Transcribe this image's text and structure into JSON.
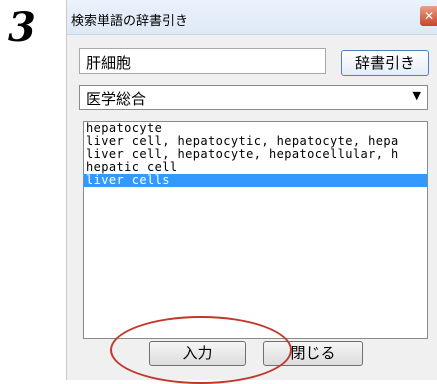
{
  "step_number": "3",
  "window": {
    "title": "検索単語の辞書引き"
  },
  "search": {
    "value": "肝細胞"
  },
  "lookup_button": "辞書引き",
  "dictionary_select": {
    "selected": "医学総合"
  },
  "results": [
    "hepatocyte",
    "liver cell, hepatocytic, hepatocyte, hepa",
    "liver cell, hepatocyte, hepatocellular, h",
    "hepatic cell",
    "liver cells"
  ],
  "selected_index": 4,
  "buttons": {
    "input": "入力",
    "close": "閉じる"
  }
}
